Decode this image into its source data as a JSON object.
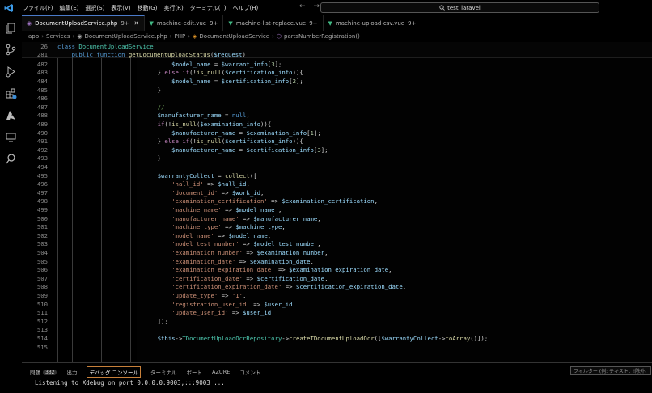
{
  "titlebar": {
    "menu": [
      "ファイル(F)",
      "編集(E)",
      "選択(S)",
      "表示(V)",
      "移動(G)",
      "実行(R)",
      "ターミナル(T)",
      "ヘルプ(H)"
    ],
    "search_text": "test_laravel"
  },
  "tabs": [
    {
      "label": "DocumentUploadService.php",
      "badge": "9+",
      "type": "php",
      "active": true
    },
    {
      "label": "machine-edit.vue",
      "badge": "9+",
      "type": "vue",
      "active": false
    },
    {
      "label": "machine-list-replace.vue",
      "badge": "9+",
      "type": "vue",
      "active": false
    },
    {
      "label": "machine-upload-csv.vue",
      "badge": "9+",
      "type": "vue",
      "active": false
    }
  ],
  "breadcrumb": [
    "app",
    "Services",
    "DocumentUploadService.php",
    "PHP",
    "DocumentUploadService",
    "partsNumberRegistration()"
  ],
  "editor": {
    "sticky": [
      {
        "num": "26",
        "text": "class DocumentUploadService"
      },
      {
        "num": "281",
        "text": "    public function getDocumentUploadStatus($request)"
      }
    ],
    "lines": [
      {
        "num": "482",
        "text": "        $model_name = $warrant_info[3];"
      },
      {
        "num": "483",
        "text": "    } else if(!is_null($certification_info)){"
      },
      {
        "num": "484",
        "text": "        $model_name = $certification_info[2];"
      },
      {
        "num": "485",
        "text": "    }"
      },
      {
        "num": "486",
        "text": ""
      },
      {
        "num": "487",
        "text": "    //"
      },
      {
        "num": "488",
        "text": "    $manufacturer_name = null;"
      },
      {
        "num": "489",
        "text": "    if(!is_null($examination_info)){"
      },
      {
        "num": "490",
        "text": "        $manufacturer_name = $examination_info[1];"
      },
      {
        "num": "491",
        "text": "    } else if(!is_null($certification_info)){"
      },
      {
        "num": "492",
        "text": "        $manufacturer_name = $certification_info[3];"
      },
      {
        "num": "493",
        "text": "    }"
      },
      {
        "num": "494",
        "text": ""
      },
      {
        "num": "495",
        "text": "    $warrantyCollect = collect(["
      },
      {
        "num": "496",
        "text": "        'hall_id' => $hall_id,"
      },
      {
        "num": "497",
        "text": "        'document_id' => $work_id,"
      },
      {
        "num": "498",
        "text": "        'examination_certification' => $examination_certification,"
      },
      {
        "num": "499",
        "text": "        'machine_name' => $model_name ,"
      },
      {
        "num": "500",
        "text": "        'manufacturer_name' => $manufacturer_name,"
      },
      {
        "num": "501",
        "text": "        'machine_type' => $machine_type,"
      },
      {
        "num": "502",
        "text": "        'model_name' => $model_name,"
      },
      {
        "num": "503",
        "text": "        'model_test_number' => $model_test_number,"
      },
      {
        "num": "504",
        "text": "        'examination_number' => $examination_number,"
      },
      {
        "num": "505",
        "text": "        'examination_date' => $examination_date,"
      },
      {
        "num": "506",
        "text": "        'examination_expiration_date' => $examination_expiration_date,"
      },
      {
        "num": "507",
        "text": "        'certification_date' => $certification_date,"
      },
      {
        "num": "508",
        "text": "        'certification_expiration_date' => $certification_expiration_date,"
      },
      {
        "num": "509",
        "text": "        'update_type' => '1',"
      },
      {
        "num": "510",
        "text": "        'registration_user_id' => $user_id,"
      },
      {
        "num": "511",
        "text": "        'update_user_id' => $user_id"
      },
      {
        "num": "512",
        "text": "    ]);"
      },
      {
        "num": "513",
        "text": ""
      },
      {
        "num": "514",
        "text": "    $this->TDocumentUploadOcrRepository->createTDocumentUploadOcr([$warrantyCollect->toArray()]);"
      },
      {
        "num": "515",
        "text": ""
      }
    ]
  },
  "panel": {
    "tabs": [
      {
        "label": "問題",
        "badge": "332"
      },
      {
        "label": "出力"
      },
      {
        "label": "デバッグ コンソール",
        "active": true
      },
      {
        "label": "ターミナル"
      },
      {
        "label": "ポート"
      },
      {
        "label": "AZURE"
      },
      {
        "label": "コメント"
      }
    ],
    "filter_placeholder": "フィルター (例: テキスト、!除外、\\エス",
    "console_output": "Listening to Xdebug on port 0.0.0.0:9003,:::9003 ..."
  }
}
